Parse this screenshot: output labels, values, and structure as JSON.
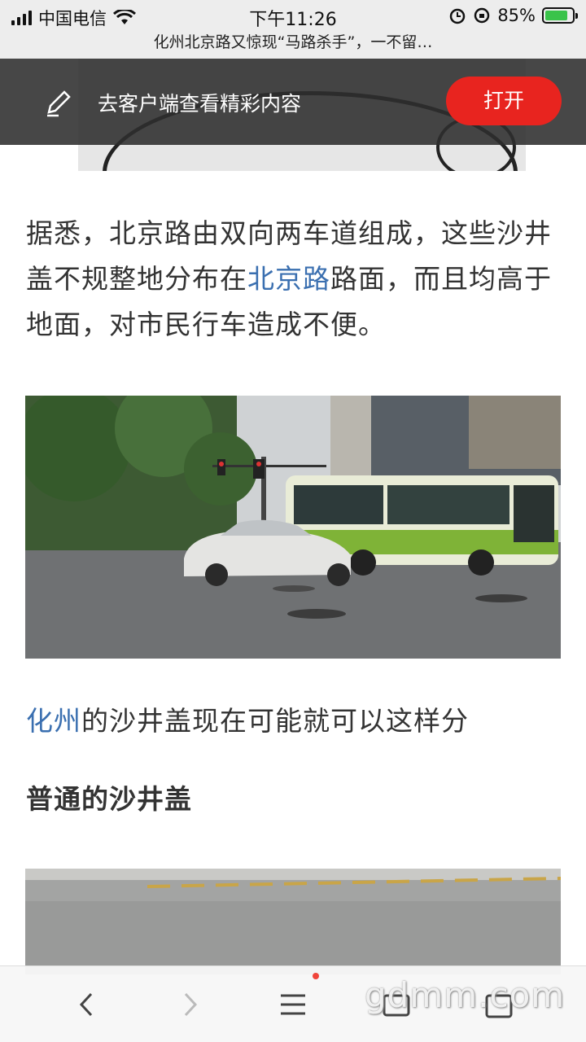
{
  "status_bar": {
    "carrier": "中国电信",
    "time": "下午11:26",
    "battery_percent": "85%",
    "battery_level": 0.85,
    "battery_color": "#3ac34a"
  },
  "page_title": "化州北京路又惊现“马路杀手”，一不留…",
  "banner": {
    "text": "去客户端查看精彩内容",
    "open_button": "打开",
    "button_color": "#e8241f"
  },
  "article": {
    "para1_a": "据悉，北京路由双向两车道组成，这些沙井盖不规整地分布在",
    "para1_link": "北京路",
    "para1_b": "路面，而且均高于地面，对市民行车造成不便。",
    "para2_link": "化州",
    "para2_b": "的沙井盖现在可能就可以这样分",
    "heading": "普通的沙井盖",
    "link_color": "#3a6fb0"
  },
  "toolbar": {
    "icons": [
      "back-icon",
      "forward-icon",
      "menu-icon",
      "tabs-icon",
      "home-icon"
    ]
  },
  "watermark": "gdmm.com"
}
